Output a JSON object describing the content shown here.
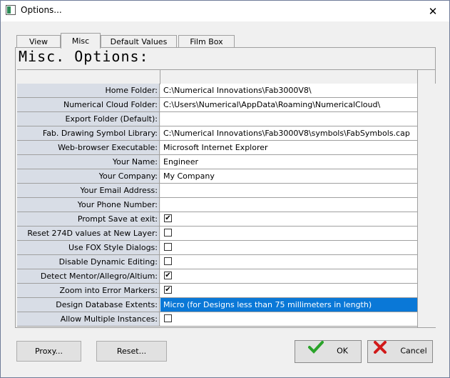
{
  "window": {
    "title": "Options..."
  },
  "tabs": [
    {
      "label": "View",
      "active": false
    },
    {
      "label": "Misc",
      "active": true
    },
    {
      "label": "Default Values",
      "active": false
    },
    {
      "label": "Film Box",
      "active": false
    }
  ],
  "panel": {
    "title": "Misc. Options:"
  },
  "rows": [
    {
      "label": "Home Folder:",
      "value": "C:\\Numerical Innovations\\Fab3000V8\\"
    },
    {
      "label": "Numerical Cloud Folder:",
      "value": "C:\\Users\\Numerical\\AppData\\Roaming\\NumericalCloud\\"
    },
    {
      "label": "Export Folder (Default):",
      "value": ""
    },
    {
      "label": "Fab. Drawing Symbol Library:",
      "value": "C:\\Numerical Innovations\\Fab3000V8\\symbols\\FabSymbols.cap"
    },
    {
      "label": "Web-browser Executable:",
      "value": "Microsoft Internet Explorer"
    },
    {
      "label": "Your Name:",
      "value": "Engineer"
    },
    {
      "label": "Your Company:",
      "value": "My Company"
    },
    {
      "label": "Your Email Address:",
      "value": ""
    },
    {
      "label": "Your Phone Number:",
      "value": ""
    },
    {
      "label": "Prompt Save at exit:",
      "checked": true
    },
    {
      "label": "Reset 274D values at New Layer:",
      "checked": false
    },
    {
      "label": "Use FOX Style Dialogs:",
      "checked": false
    },
    {
      "label": "Disable Dynamic Editing:",
      "checked": false
    },
    {
      "label": "Detect Mentor/Allegro/Altium:",
      "checked": true
    },
    {
      "label": "Zoom into Error Markers:",
      "checked": true
    },
    {
      "label": "Design Database Extents:",
      "value": "Micro (for Designs less than 75 millimeters in length)",
      "selected": true
    },
    {
      "label": "Allow Multiple Instances:",
      "checked": false
    }
  ],
  "buttons": {
    "proxy": "Proxy...",
    "reset": "Reset...",
    "ok": "OK",
    "cancel": "Cancel"
  },
  "colors": {
    "selection": "#0a78d7",
    "label_bg": "#d8dde6",
    "ok_icon": "#2aa32a",
    "cancel_icon": "#d11a1a"
  },
  "icons": {
    "close": "close-icon",
    "ok": "checkmark-icon",
    "cancel": "x-icon"
  }
}
